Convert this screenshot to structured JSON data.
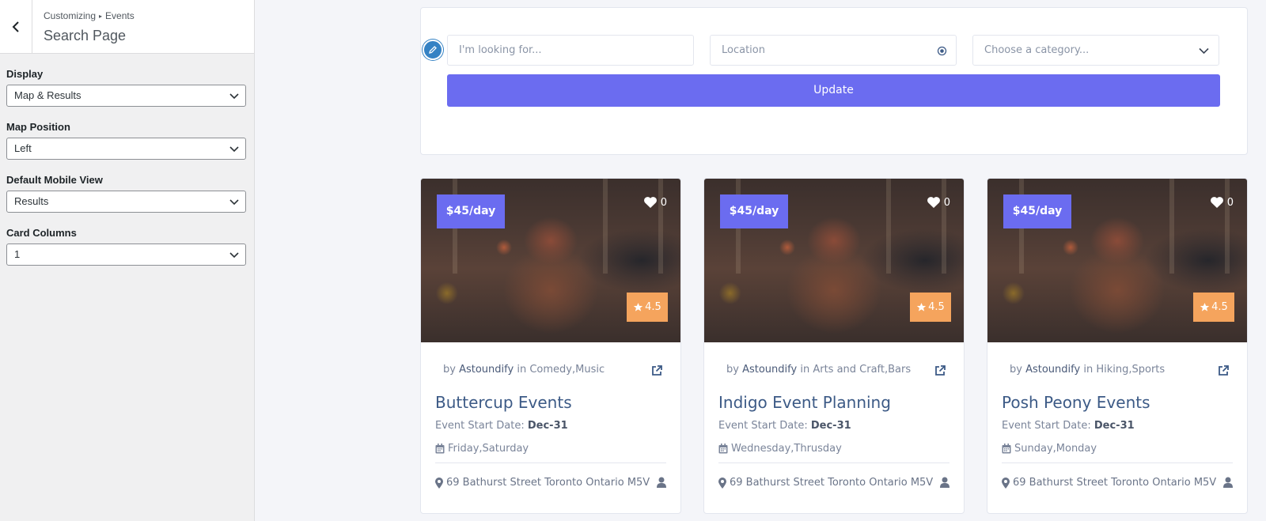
{
  "sidebar": {
    "breadcrumb": {
      "parent": "Customizing",
      "separator": "▸",
      "current": "Events"
    },
    "title": "Search Page",
    "fields": [
      {
        "label": "Display",
        "value": "Map & Results"
      },
      {
        "label": "Map Position",
        "value": "Left"
      },
      {
        "label": "Default Mobile View",
        "value": "Results"
      },
      {
        "label": "Card Columns",
        "value": "1"
      }
    ]
  },
  "search": {
    "keyword_placeholder": "I'm looking for...",
    "location_placeholder": "Location",
    "category_placeholder": "Choose a category...",
    "update_label": "Update"
  },
  "colors": {
    "accent": "#6b6cf0",
    "rating": "#f5a45d",
    "title": "#3c5a86",
    "edit_pen": "#3582c4"
  },
  "cards": [
    {
      "price": "$45/day",
      "favorites": "0",
      "rating": "4.5",
      "by": "by",
      "author": "Astoundify",
      "in": "in",
      "categories": "Comedy,Music",
      "title": "Buttercup Events",
      "start_label": "Event Start Date:",
      "start_date": "Dec-31",
      "days": "Friday,Saturday",
      "address": "69 Bathurst Street Toronto Ontario M5V"
    },
    {
      "price": "$45/day",
      "favorites": "0",
      "rating": "4.5",
      "by": "by",
      "author": "Astoundify",
      "in": "in",
      "categories": "Arts and Craft,Bars",
      "title": "Indigo Event Planning",
      "start_label": "Event Start Date:",
      "start_date": "Dec-31",
      "days": "Wednesday,Thrusday",
      "address": "69 Bathurst Street Toronto Ontario M5V"
    },
    {
      "price": "$45/day",
      "favorites": "0",
      "rating": "4.5",
      "by": "by",
      "author": "Astoundify",
      "in": "in",
      "categories": "Hiking,Sports",
      "title": "Posh Peony Events",
      "start_label": "Event Start Date:",
      "start_date": "Dec-31",
      "days": "Sunday,Monday",
      "address": "69 Bathurst Street Toronto Ontario M5V"
    }
  ]
}
